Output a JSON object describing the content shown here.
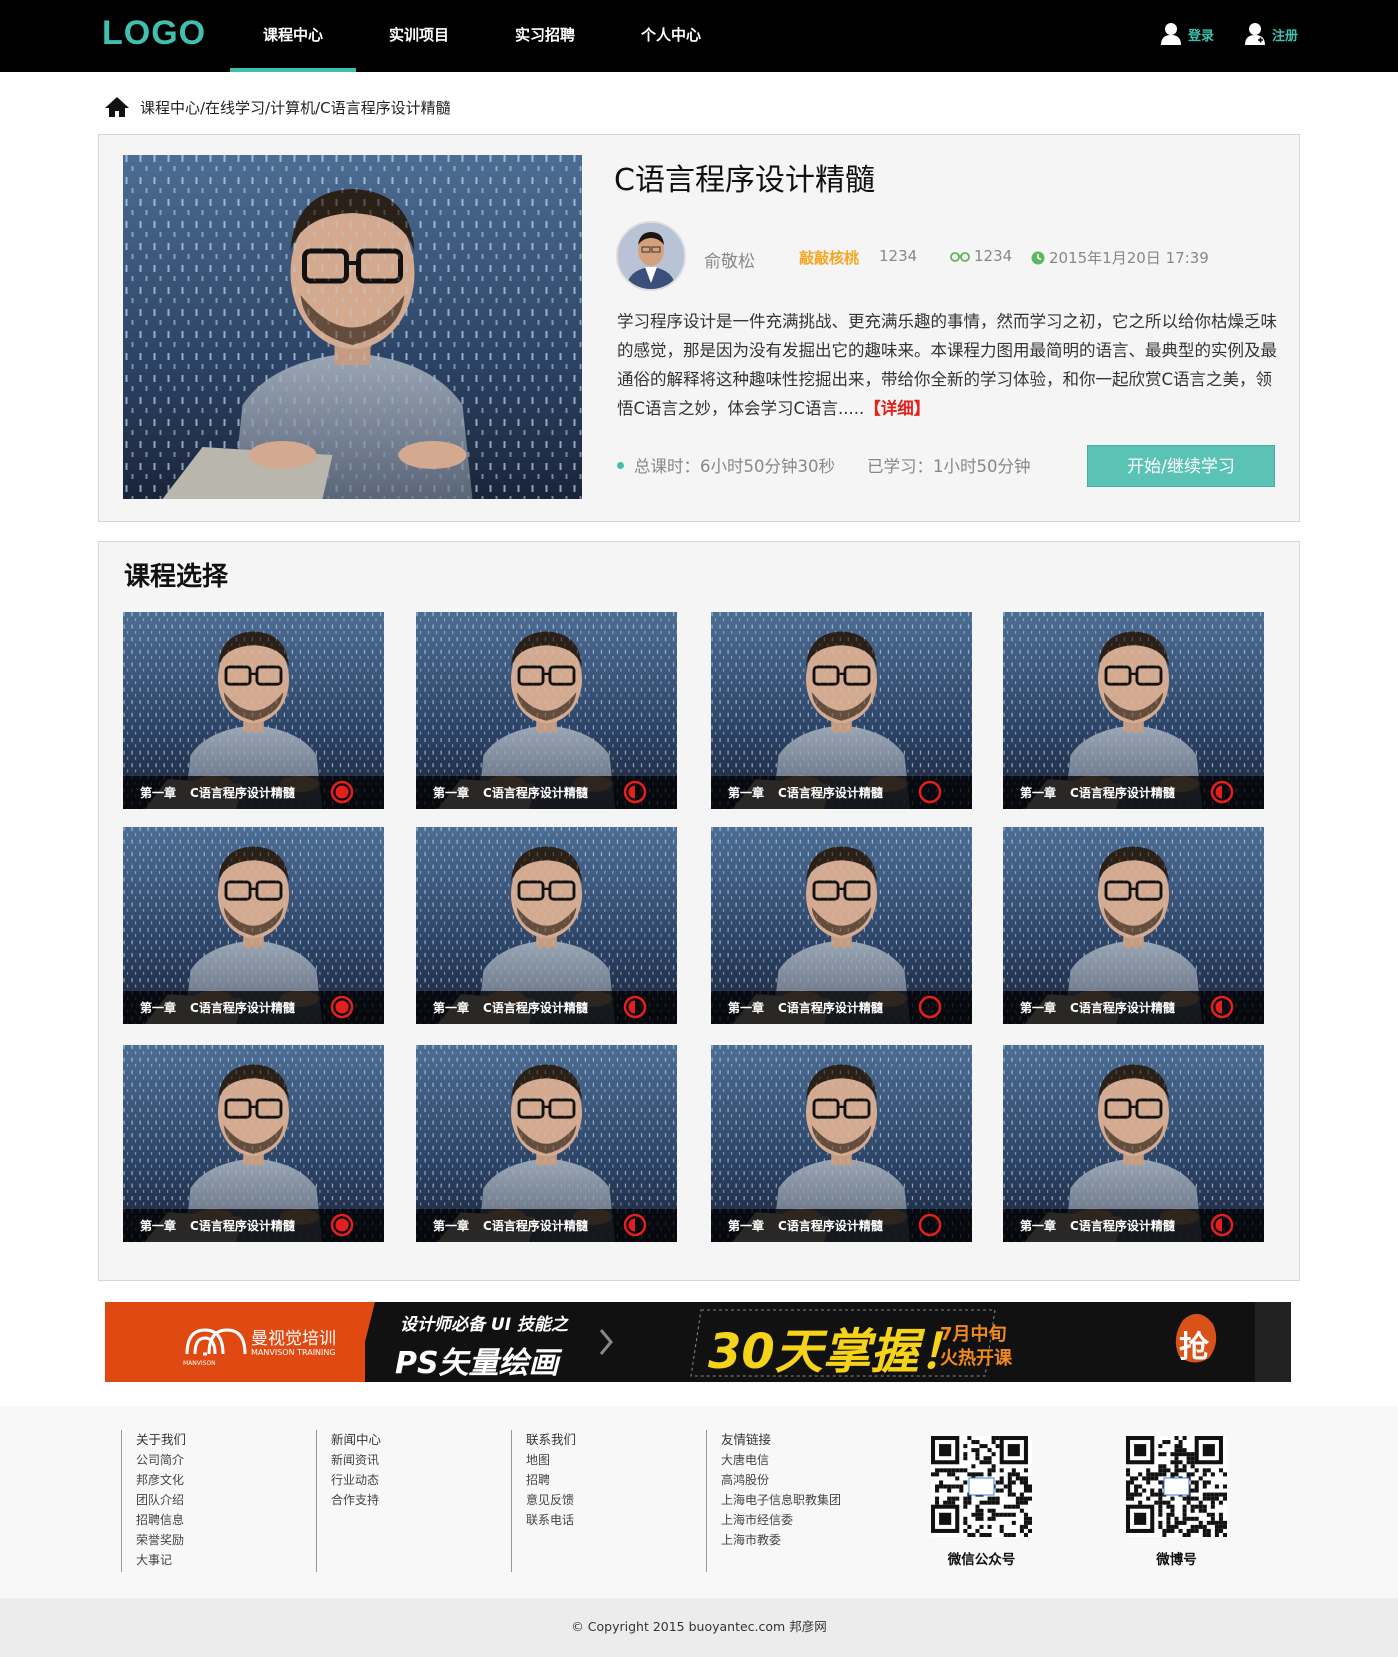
{
  "header": {
    "logo": "LOGO",
    "nav": [
      {
        "label": "课程中心",
        "active": true
      },
      {
        "label": "实训项目",
        "active": false
      },
      {
        "label": "实习招聘",
        "active": false
      },
      {
        "label": "个人中心",
        "active": false
      }
    ],
    "login": "登录",
    "register": "注册",
    "accent": "#3fbfae"
  },
  "breadcrumb": "课程中心/在线学习/计算机/C语言程序设计精髓",
  "course": {
    "title": "C语言程序设计精髓",
    "teacher": "俞敬松",
    "school": "敲敲核桃",
    "school_count": "1234",
    "views": "1234",
    "date": "2015年1月20日  17:39",
    "description": "学习程序设计是一件充满挑战、更充满乐趣的事情，然而学习之初，它之所以给你枯燥乏味的感觉，那是因为没有发掘出它的趣味来。本课程力图用最简明的语言、最典型的实例及最通俗的解释将这种趣味性挖掘出来，带给你全新的学习体验，和你一起欣赏C语言之美，领悟C语言之妙，体会学习C语言.....",
    "more": "【详细】",
    "total_time": "总课时：6小时50分钟30秒",
    "learned": "已学习：1小时50分钟",
    "start_button": "开始/继续学习"
  },
  "selection": {
    "title": "课程选择",
    "chapter": "第一章",
    "lesson": "C语言程序设计精髓",
    "status_icons": [
      "full-progress-icon",
      "half-progress-icon",
      "empty-progress-icon",
      "half-progress-icon"
    ]
  },
  "banner": {
    "brand_cn": "曼视觉培训",
    "brand_en": "MANVISON TRAINING",
    "brand_logo": "MANVISON",
    "line1": "设计师必备 UI 技能之",
    "line2": "PS矢量绘画",
    "big": "30天掌握！",
    "promo1": "7月中旬",
    "promo2": "火热开课",
    "grab": "抢"
  },
  "footer": {
    "columns": [
      {
        "title": "关于我们",
        "items": [
          "公司简介",
          "邦彦文化",
          "团队介绍",
          "招聘信息",
          "荣誉奖励",
          "大事记"
        ]
      },
      {
        "title": "新闻中心",
        "items": [
          "新闻资讯",
          "行业动态",
          "合作支持"
        ]
      },
      {
        "title": "联系我们",
        "items": [
          "地图",
          "招聘",
          "意见反馈",
          "联系电话"
        ]
      },
      {
        "title": "友情链接",
        "items": [
          "大唐电信",
          "高鸿股份",
          "上海电子信息职教集团",
          "上海市经信委",
          "上海市教委"
        ]
      }
    ],
    "qr1_label": "微信公众号",
    "qr2_label": "微博号",
    "copyright": "© Copyright 2015 buoyantec.com 邦彦网"
  }
}
